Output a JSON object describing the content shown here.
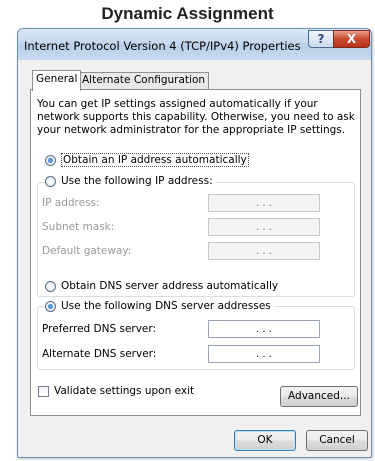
{
  "caption": "Dynamic Assignment",
  "window": {
    "title": "Internet Protocol Version 4 (TCP/IPv4) Properties",
    "help_label": "?",
    "close_label": "X"
  },
  "tabs": [
    {
      "label": "General",
      "active": true
    },
    {
      "label": "Alternate Configuration",
      "active": false
    }
  ],
  "description": "You can get IP settings assigned automatically if your network supports this capability. Otherwise, you need to ask your network administrator for the appropriate IP settings.",
  "ip_options": {
    "auto": {
      "label": "Obtain an IP address automatically",
      "checked": true
    },
    "manual": {
      "label": "Use the following IP address:",
      "checked": false
    }
  },
  "ip_fields": [
    {
      "label": "IP address:",
      "value": ". . ."
    },
    {
      "label": "Subnet mask:",
      "value": ". . ."
    },
    {
      "label": "Default gateway:",
      "value": ". . ."
    }
  ],
  "dns_options": {
    "auto": {
      "label": "Obtain DNS server address automatically",
      "checked": false
    },
    "manual": {
      "label": "Use the following DNS server addresses",
      "checked": true
    }
  },
  "dns_fields": [
    {
      "label": "Preferred DNS server:",
      "value": ". . ."
    },
    {
      "label": "Alternate DNS server:",
      "value": ". . ."
    }
  ],
  "validate": {
    "label": "Validate settings upon exit",
    "checked": false
  },
  "buttons": {
    "advanced": "Advanced...",
    "ok": "OK",
    "cancel": "Cancel"
  }
}
